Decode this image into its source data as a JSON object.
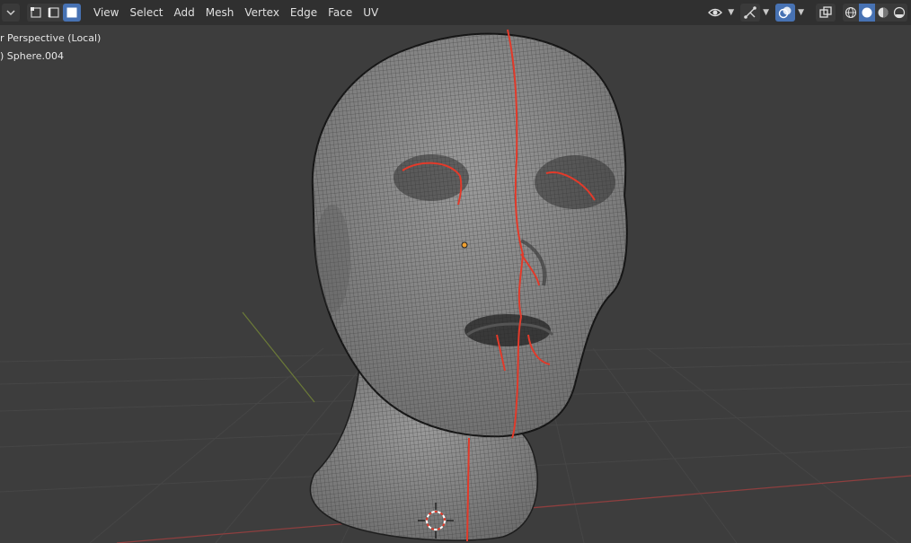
{
  "header": {
    "menu": [
      "View",
      "Select",
      "Add",
      "Mesh",
      "Vertex",
      "Edge",
      "Face",
      "UV"
    ],
    "select_modes": [
      "vertex-select-icon",
      "edge-select-icon",
      "face-select-icon"
    ],
    "active_select_mode": "face-select-icon",
    "right_icons": [
      "visibility-icon",
      "gizmo-icon",
      "overlay-icon",
      "xray-icon"
    ],
    "shading_modes": [
      "wireframe-shading-icon",
      "solid-shading-icon",
      "material-preview-icon",
      "rendered-shading-icon"
    ],
    "active_shading": "solid-shading-icon"
  },
  "viewport": {
    "view_label": "r Perspective (Local)",
    "object_label": ") Sphere.004"
  },
  "colors": {
    "background": "#3d3d3d",
    "header": "#303030",
    "accent": "#4772b3",
    "seam": "#e23a2a",
    "mesh": "#8a8a8a",
    "x_axis": "#9a3d3d",
    "y_axis": "#6b7a38"
  }
}
